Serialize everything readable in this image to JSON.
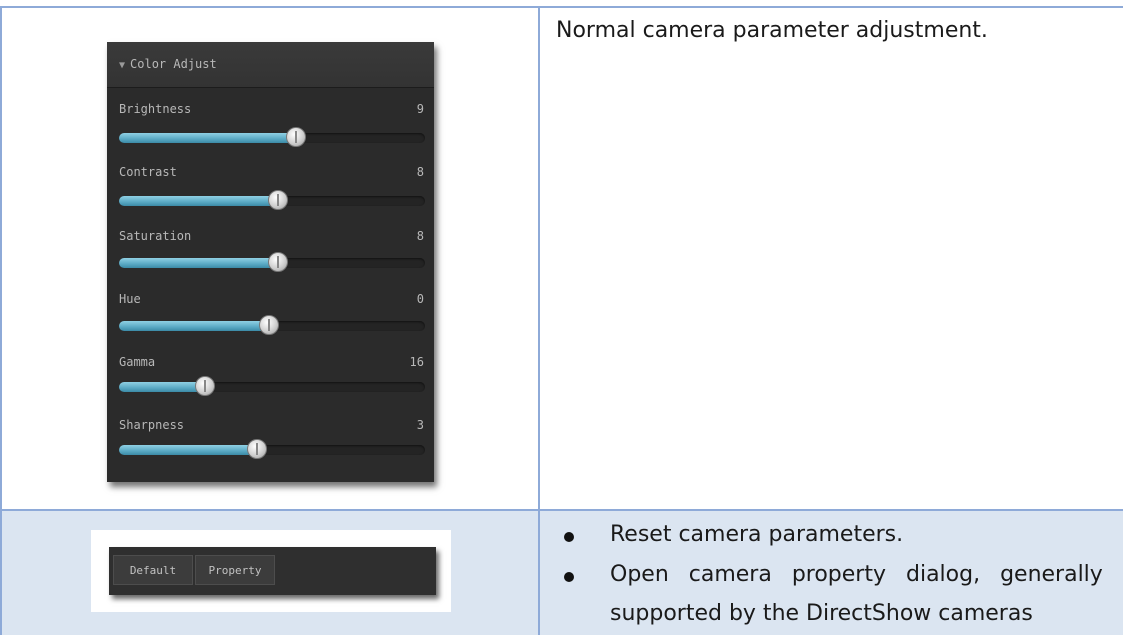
{
  "row1": {
    "description": "Normal camera parameter adjustment.",
    "panel": {
      "title": "Color Adjust",
      "sliders": [
        {
          "label": "Brightness",
          "value": "9",
          "fill_fraction": 0.58
        },
        {
          "label": "Contrast",
          "value": "8",
          "fill_fraction": 0.52
        },
        {
          "label": "Saturation",
          "value": "8",
          "fill_fraction": 0.52
        },
        {
          "label": "Hue",
          "value": "0",
          "fill_fraction": 0.49
        },
        {
          "label": "Gamma",
          "value": "16",
          "fill_fraction": 0.28
        },
        {
          "label": "Sharpness",
          "value": "3",
          "fill_fraction": 0.45
        }
      ]
    }
  },
  "row2": {
    "buttons": {
      "default_label": "Default",
      "property_label": "Property"
    },
    "bullets": [
      "Reset camera parameters.",
      "Open camera property dialog, generally supported by the DirectShow cameras"
    ],
    "bullet_line1": "Open camera property dialog, generally",
    "bullet_line2": "supported by the DirectShow cameras"
  },
  "colors": {
    "table_border": "#8eaad8",
    "row2_background": "#dbe5f1",
    "panel_background": "#2b2b2b",
    "slider_fill": "#5aa9c4"
  }
}
